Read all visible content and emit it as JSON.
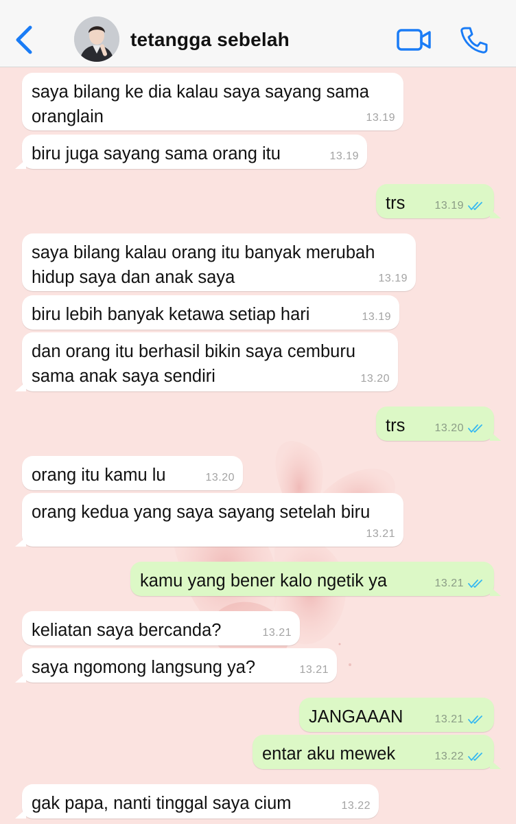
{
  "header": {
    "back_icon": "chevron-left-icon",
    "contact_name": "tetangga sebelah",
    "video_icon": "video-camera-icon",
    "call_icon": "phone-icon",
    "accent": "#1a7cf6"
  },
  "colors": {
    "incoming": "#ffffff",
    "outgoing": "#dcf8c6",
    "read_ticks": "#34b7f1",
    "background": "#fbe3e0"
  },
  "messages": [
    {
      "direction": "in",
      "text": "saya bilang ke dia kalau saya sayang sama\noranglain",
      "time": "13.19"
    },
    {
      "direction": "in",
      "text": "biru juga sayang sama orang itu",
      "time": "13.19"
    },
    {
      "direction": "out",
      "text": "trs",
      "time": "13.19",
      "status": "read"
    },
    {
      "direction": "in",
      "text": "saya bilang kalau orang itu banyak merubah\nhidup saya dan anak saya",
      "time": "13.19"
    },
    {
      "direction": "in",
      "text": "biru lebih banyak ketawa setiap hari",
      "time": "13.19"
    },
    {
      "direction": "in",
      "text": "dan orang itu berhasil bikin saya cemburu\nsama anak saya sendiri",
      "time": "13.20"
    },
    {
      "direction": "out",
      "text": "trs",
      "time": "13.20",
      "status": "read"
    },
    {
      "direction": "in",
      "text": "orang itu kamu lu",
      "time": "13.20"
    },
    {
      "direction": "in",
      "text": "orang kedua yang saya sayang setelah biru",
      "time": "13.21"
    },
    {
      "direction": "out",
      "text": "kamu yang bener kalo ngetik ya",
      "time": "13.21",
      "status": "read"
    },
    {
      "direction": "in",
      "text": "keliatan saya bercanda?",
      "time": "13.21"
    },
    {
      "direction": "in",
      "text": "saya ngomong langsung ya?",
      "time": "13.21"
    },
    {
      "direction": "out",
      "text": "JANGAAAN",
      "time": "13.21",
      "status": "read"
    },
    {
      "direction": "out",
      "text": "entar aku mewek",
      "time": "13.22",
      "status": "read"
    },
    {
      "direction": "in",
      "text": "gak papa, nanti tinggal saya cium",
      "time": "13.22"
    }
  ]
}
